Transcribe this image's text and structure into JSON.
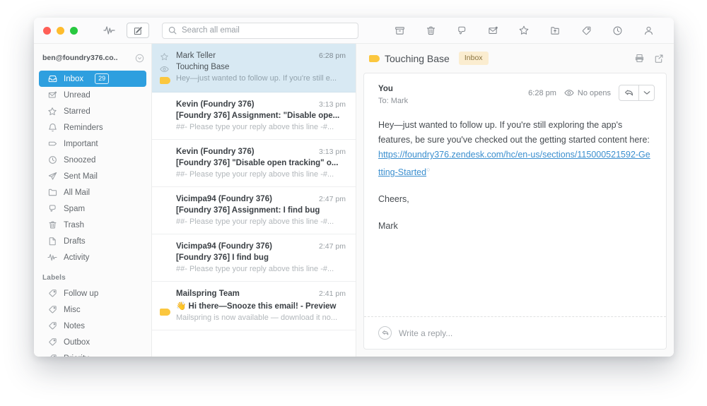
{
  "titlebar": {
    "activity_icon": "activity-pulse-icon",
    "compose_icon": "compose-icon",
    "search": {
      "placeholder": "Search all email",
      "icon": "search-icon"
    },
    "actions": [
      {
        "name": "archive-button",
        "icon": "archive-icon"
      },
      {
        "name": "trash-button",
        "icon": "trash-icon"
      },
      {
        "name": "spam-button",
        "icon": "thumbs-down-icon"
      },
      {
        "name": "mark-unread-button",
        "icon": "envelope-unread-icon"
      },
      {
        "name": "star-button",
        "icon": "star-icon"
      },
      {
        "name": "move-folder-button",
        "icon": "folder-move-icon"
      },
      {
        "name": "label-button",
        "icon": "tag-icon"
      },
      {
        "name": "snooze-button",
        "icon": "clock-icon"
      },
      {
        "name": "contact-button",
        "icon": "person-icon"
      }
    ]
  },
  "sidebar": {
    "account": "ben@foundry376.co..",
    "account_chevron": "chevron-down-circle-icon",
    "items": [
      {
        "label": "Inbox",
        "icon": "inbox-icon",
        "badge": "29",
        "active": true
      },
      {
        "label": "Unread",
        "icon": "envelope-unread-icon",
        "badge": "",
        "active": false
      },
      {
        "label": "Starred",
        "icon": "star-icon",
        "badge": "",
        "active": false
      },
      {
        "label": "Reminders",
        "icon": "bell-icon",
        "badge": "",
        "active": false
      },
      {
        "label": "Important",
        "icon": "tag-outline-icon",
        "badge": "",
        "active": false
      },
      {
        "label": "Snoozed",
        "icon": "clock-icon",
        "badge": "",
        "active": false
      },
      {
        "label": "Sent Mail",
        "icon": "send-icon",
        "badge": "",
        "active": false
      },
      {
        "label": "All Mail",
        "icon": "folder-icon",
        "badge": "",
        "active": false
      },
      {
        "label": "Spam",
        "icon": "thumbs-down-icon",
        "badge": "",
        "active": false
      },
      {
        "label": "Trash",
        "icon": "trash-icon",
        "badge": "",
        "active": false
      },
      {
        "label": "Drafts",
        "icon": "document-icon",
        "badge": "",
        "active": false
      },
      {
        "label": "Activity",
        "icon": "activity-pulse-icon",
        "badge": "",
        "active": false
      }
    ],
    "labels_heading": "Labels",
    "labels": [
      {
        "label": "Follow up",
        "icon": "tag-icon"
      },
      {
        "label": "Misc",
        "icon": "tag-icon"
      },
      {
        "label": "Notes",
        "icon": "tag-icon"
      },
      {
        "label": "Outbox",
        "icon": "tag-icon"
      },
      {
        "label": "Priority",
        "icon": "tag-icon"
      }
    ]
  },
  "message_list": [
    {
      "from": "Mark Teller",
      "time": "6:28 pm",
      "subject": "Touching Base",
      "snippet": "Hey—just wanted to follow up. If you're still e...",
      "selected": true,
      "has_star": true,
      "has_eye": true,
      "has_folder_tag": true
    },
    {
      "from": "Kevin (Foundry 376)",
      "time": "3:13 pm",
      "subject": "[Foundry 376] Assignment: \"Disable ope...",
      "snippet": "##- Please type your reply above this line -#...",
      "selected": false,
      "has_star": false,
      "has_eye": false,
      "has_folder_tag": false
    },
    {
      "from": "Kevin (Foundry 376)",
      "time": "3:13 pm",
      "subject": "[Foundry 376] \"Disable open tracking\" o...",
      "snippet": "##- Please type your reply above this line -#...",
      "selected": false,
      "has_star": false,
      "has_eye": false,
      "has_folder_tag": false
    },
    {
      "from": "Vicimpa94 (Foundry 376)",
      "time": "2:47 pm",
      "subject": "[Foundry 376] Assignment: I find bug",
      "snippet": "##- Please type your reply above this line -#...",
      "selected": false,
      "has_star": false,
      "has_eye": false,
      "has_folder_tag": false
    },
    {
      "from": "Vicimpa94 (Foundry 376)",
      "time": "2:47 pm",
      "subject": "[Foundry 376] I find bug",
      "snippet": "##- Please type your reply above this line -#...",
      "selected": false,
      "has_star": false,
      "has_eye": false,
      "has_folder_tag": false
    },
    {
      "from": "Mailspring Team",
      "time": "2:41 pm",
      "subject": "👋 Hi there—Snooze this email! - Preview",
      "snippet": "Mailspring is now available — download it no...",
      "selected": false,
      "has_star": false,
      "has_eye": false,
      "has_folder_tag": true
    }
  ],
  "detail": {
    "folder_icon": "folder-tag-icon",
    "title": "Touching Base",
    "chip": "Inbox",
    "print_icon": "print-icon",
    "popout_icon": "popout-icon",
    "sender": "You",
    "recipient": "To: Mark",
    "time": "6:28 pm",
    "opens_icon": "eye-icon",
    "opens": "No opens",
    "reply_icon": "reply-arrow-icon",
    "reply_dropdown_icon": "chevron-down-icon",
    "body_para1_pre": "Hey—just wanted to follow up. If you're still exploring the app's features, be sure you've checked out the getting started content here: ",
    "body_link": "https://foundry376.zendesk.com/hc/en-us/sections/115000521592-Getting-Started",
    "body_para2": "Cheers,",
    "body_para3": "Mark",
    "reply_placeholder": "Write a reply...",
    "reply_circle_icon": "reply-arrow-circle-icon"
  },
  "colors": {
    "accent": "#2e9fdf",
    "selection": "#d8e9f3",
    "chip_bg": "#fbedd0",
    "chip_text": "#8a7440",
    "folder_tag": "#fbc73f",
    "link": "#3b8fcf"
  }
}
